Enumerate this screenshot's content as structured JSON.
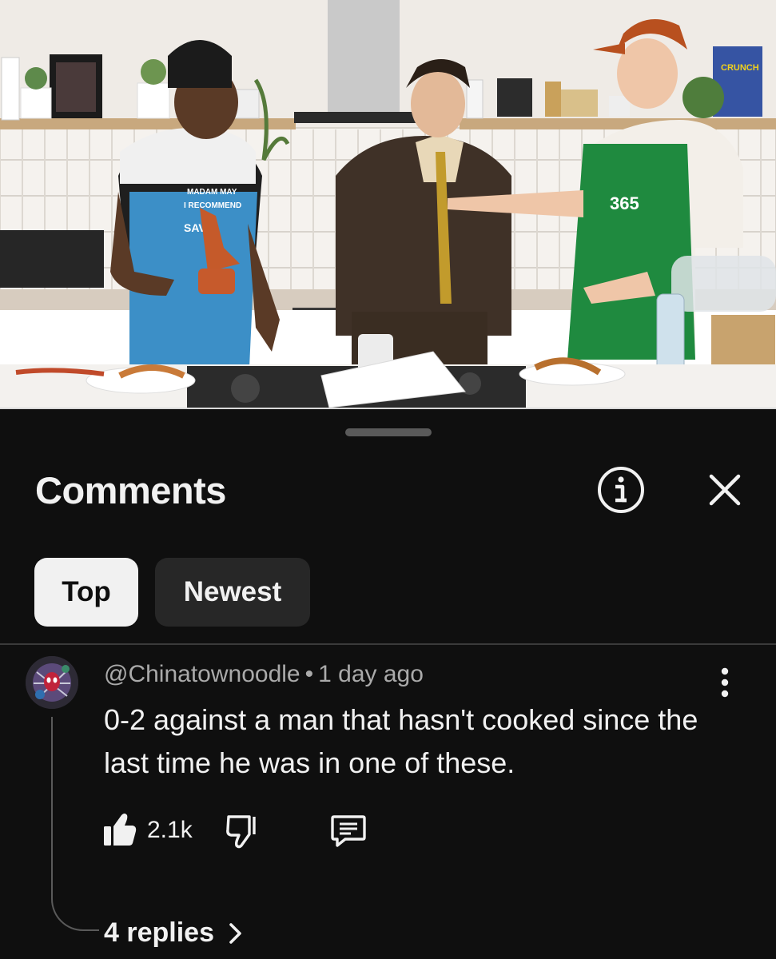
{
  "sheet": {
    "title": "Comments",
    "info_icon": "info-icon",
    "close_icon": "close-icon"
  },
  "sort_chips": [
    {
      "label": "Top",
      "selected": true
    },
    {
      "label": "Newest",
      "selected": false
    }
  ],
  "comment": {
    "author": "@Chinatownoodle",
    "separator": "•",
    "time": "1 day ago",
    "text": "0-2 against a man that hasn't cooked since the last time he was in one of these.",
    "likes": "2.1k",
    "icons": {
      "like": "thumbs-up-icon",
      "dislike": "thumbs-down-icon",
      "reply": "reply-icon",
      "more": "more-vert-icon"
    },
    "replies_label": "4 replies"
  },
  "video": {
    "apron_text_left": [
      "MADAM MAY",
      "I RECOMMEND",
      "SAVE"
    ],
    "apron_text_right": "365",
    "cereal_box": "CRUNCH"
  },
  "colors": {
    "background": "#0f0f0f",
    "chip_selected": "#f1f1f1",
    "chip_unselected": "#272727",
    "secondary_text": "#aaaaaa",
    "apron_blue": "#3c8fc7",
    "apron_green": "#1f8a3f",
    "cap_orange": "#b8501f"
  }
}
